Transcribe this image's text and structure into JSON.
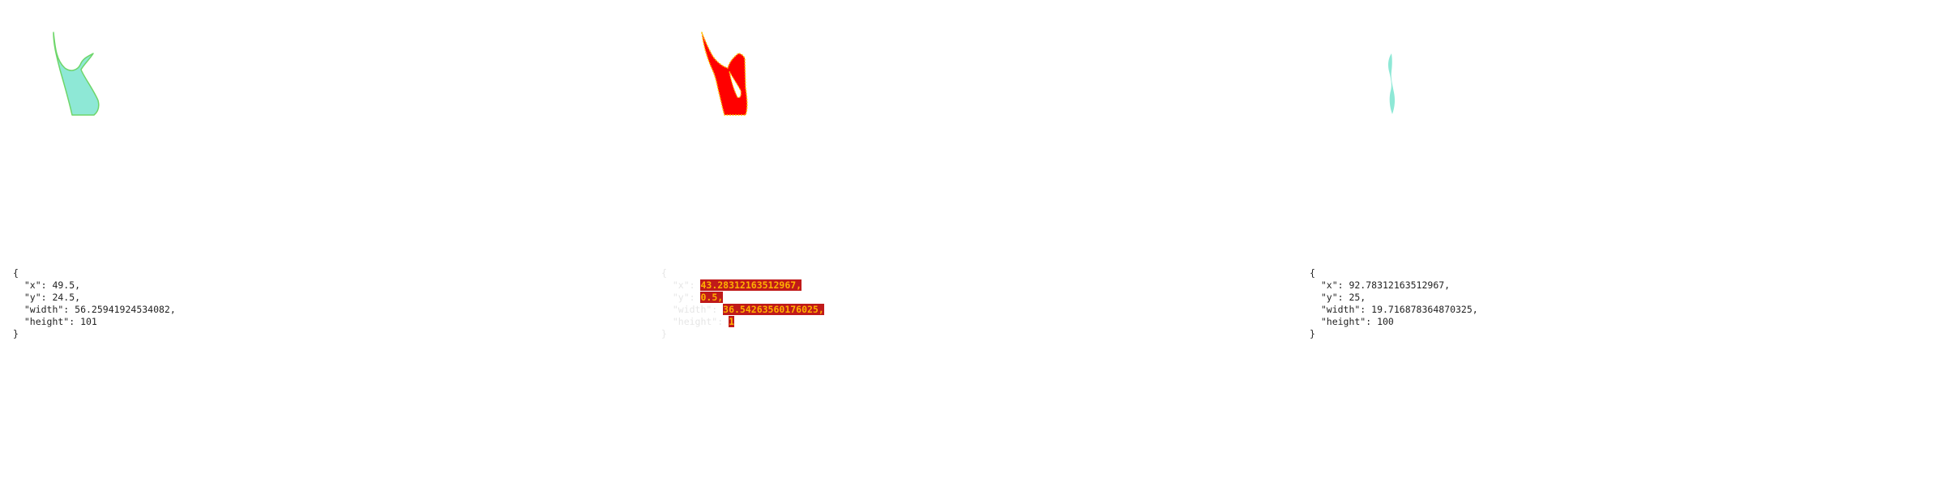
{
  "panels": {
    "left": {
      "shape_name": "green-pennant-shape",
      "colors": {
        "fill": "#8ee8d6",
        "stroke": "#6ed66a"
      },
      "readout": {
        "open": "{",
        "close": "}",
        "x_line": "\"x\": 49.5,",
        "y_line": "\"y\": 24.5,",
        "width_line": "\"width\": 56.25941924534082,",
        "height_line": "\"height\": 101"
      }
    },
    "middle": {
      "shape_name": "red-diff-shape",
      "colors": {
        "fill": "#ff0000",
        "outline": "#ffc400"
      },
      "readout": {
        "open": "{",
        "close": "}",
        "x_key": "\"x\": ",
        "x_val": "43.28312163512967,",
        "y_key": "\"y\": ",
        "y_val": "0.5,",
        "width_key": "\"width\": ",
        "width_val": "36.54263560176025,",
        "height_key": "\"height\": ",
        "height_val": "1"
      }
    },
    "right": {
      "shape_name": "cyan-sliver-shape",
      "colors": {
        "fill": "#8ee8d6"
      },
      "readout": {
        "open": "{",
        "close": "}",
        "x_line": "\"x\": 92.78312163512967,",
        "y_line": "\"y\": 25,",
        "width_line": "\"width\": 19.716878364870325,",
        "height_line": "\"height\": 100"
      }
    }
  }
}
